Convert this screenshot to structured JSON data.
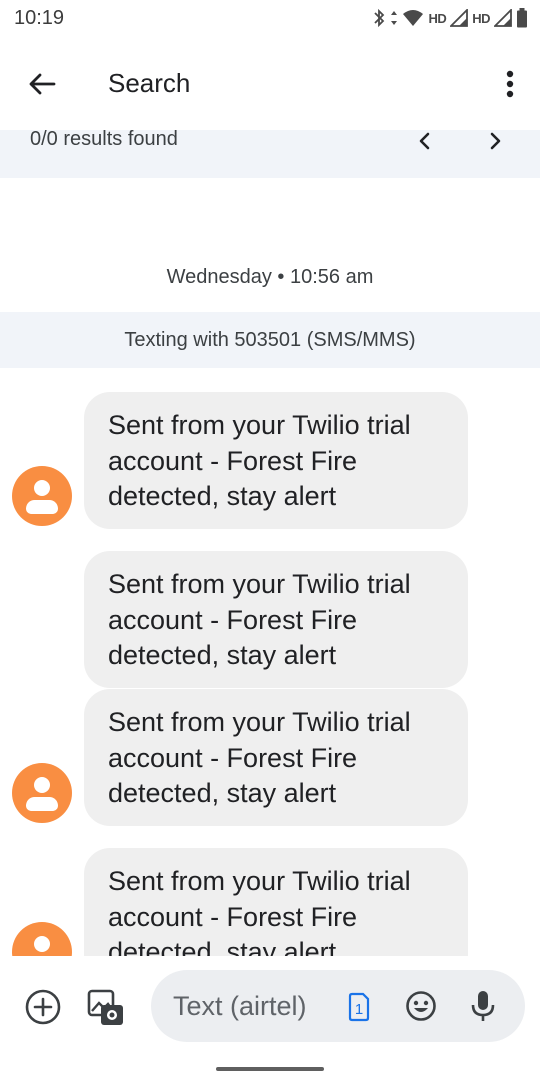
{
  "status_bar": {
    "time": "10:19",
    "hd_1": "HD",
    "hd_2": "HD"
  },
  "header": {
    "title": "Search",
    "back_icon": "arrow-back-icon",
    "menu_icon": "more-vert-icon"
  },
  "search_results": {
    "summary": "0/0 results found"
  },
  "conversation": {
    "date_label": "Wednesday • 10:56 am",
    "texting_label": "Texting with 503501 (SMS/MMS)",
    "messages": [
      {
        "text": "Sent from your Twilio trial account - Forest Fire detected, stay alert"
      },
      {
        "text": "Sent from your Twilio trial account - Forest Fire detected, stay alert"
      },
      {
        "text": "Sent from your Twilio trial account - Forest Fire detected, stay alert"
      },
      {
        "text": "Sent from your Twilio trial account - Forest Fire detected, stay alert"
      }
    ]
  },
  "compose": {
    "placeholder": "Text (airtel)",
    "sim_number": "1"
  },
  "colors": {
    "avatar": "#f98e42",
    "bubble": "#efefef",
    "banner": "#f1f4f9",
    "sim_accent": "#1a73e8"
  }
}
